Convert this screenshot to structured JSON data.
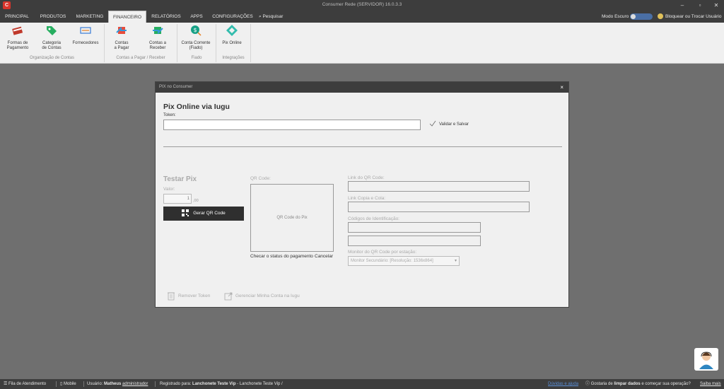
{
  "window": {
    "logo": "C",
    "title": "Consumer Rede (SERVIDOR) 16.0.3.3",
    "controls": [
      "–",
      "▫",
      "✕"
    ]
  },
  "menu": {
    "tabs": [
      "PRINCIPAL",
      "PRODUTOS",
      "MARKETING",
      "FINANCEIRO",
      "RELATÓRIOS",
      "APPS",
      "CONFIGURAÇÕES"
    ],
    "active": "FINANCEIRO",
    "search": "Pesquisar",
    "dark_mode": "Modo Escuro",
    "lock": "Bloquear ou Trocar Usuário"
  },
  "ribbon": {
    "buttons": [
      {
        "line1": "Formas de",
        "line2": "Pagamento",
        "icon": "card-icon"
      },
      {
        "line1": "Categoria",
        "line2": "de Contas",
        "icon": "tag-icon"
      },
      {
        "line1": "Fornecedores",
        "line2": "",
        "icon": "truck-icon"
      },
      {
        "line1": "Contas",
        "line2": "a Pagar",
        "icon": "pay-icon"
      },
      {
        "line1": "Contas a",
        "line2": "Receber",
        "icon": "receive-icon"
      },
      {
        "line1": "Conta Corrente",
        "line2": "(Fiado)",
        "icon": "coin-icon"
      },
      {
        "line1": "Pix Online",
        "line2": "",
        "icon": "pix-icon"
      }
    ],
    "groups": [
      "Organização de Contas",
      "Contas a Pagar / Receber",
      "Fiado",
      "Integrações"
    ]
  },
  "modal": {
    "title": "PIX no Consumer",
    "close": "×",
    "heading": "Pix Online via Iugu",
    "token_label": "Token:",
    "token_value": "",
    "validate": "Validar e Salvar",
    "test_heading": "Testar Pix",
    "value_label": "Valor:",
    "value": "1",
    "value_suffix": ",00",
    "qr_button": "Gerar QR Code",
    "qr_label": "QR Code:",
    "qr_placeholder": "QR Code do Pix",
    "check_status": "Checar o status do pagamento",
    "cancel": "Cancelar",
    "link_label": "Link do QR Code:",
    "copy_label": "Link Copia e Cola:",
    "ids_label": "Códigos de Identificação:",
    "monitor_label": "Monitor do QR Code por estação:",
    "monitor_value": "Monitor Secundário: [Resolução: 1536x864]",
    "remove_token": "Remover Token",
    "manage_account": "Gerenciar Minha Conta na Iugu"
  },
  "status": {
    "queue": "Fila de Atendimento",
    "mobile": "Mobile",
    "user_prefix": "Usuário:",
    "user_name": "Matheus",
    "user_role": "administrador",
    "registered_prefix": "Registrado para:",
    "registered_name": "Lanchonete Teste Vip",
    "registered_suffix": "- Lanchonete Teste Vip /",
    "faq": "Dúvidas e ajuda",
    "clean_pre": "Gostaria de",
    "clean_bold": "limpar dados",
    "clean_post": "e começar sua operação?",
    "know_more": "Saiba mais"
  }
}
